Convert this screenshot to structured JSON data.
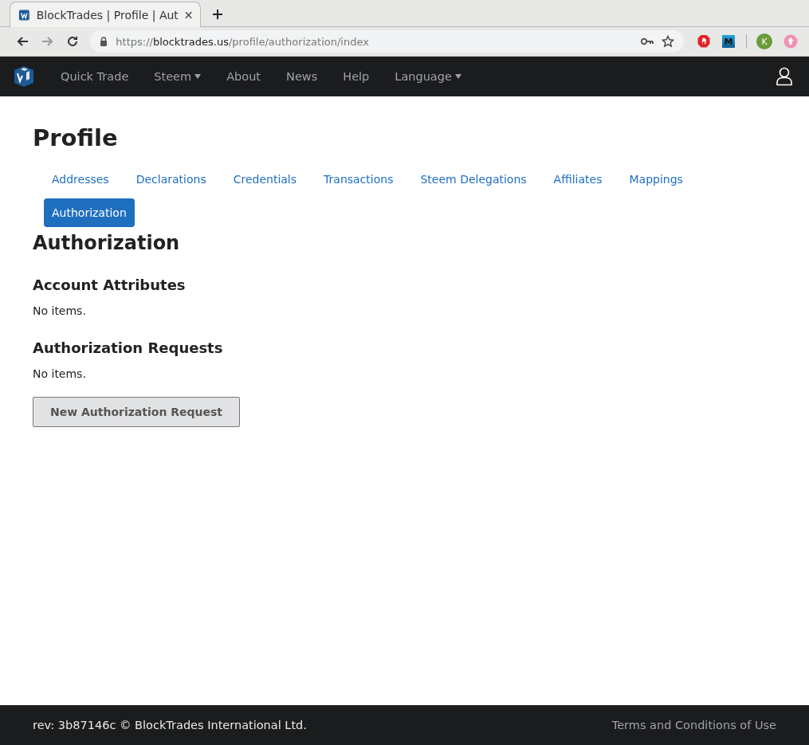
{
  "browser": {
    "tab": {
      "title": "BlockTrades | Profile | Aut"
    },
    "nav_buttons": [
      {
        "kind": "back",
        "disabled": false
      },
      {
        "kind": "forward",
        "disabled": true
      },
      {
        "kind": "reload",
        "disabled": false
      }
    ],
    "url": {
      "scheme": "https://",
      "host": "blocktrades.us",
      "path": "/profile/authorization/index"
    },
    "extensions": [
      {
        "kind": "blocker"
      },
      {
        "kind": "letter",
        "label": "M"
      },
      {
        "kind": "divider"
      },
      {
        "kind": "avatar",
        "label": "K"
      },
      {
        "kind": "upload"
      }
    ]
  },
  "navbar": {
    "items": [
      {
        "label": "Quick Trade",
        "dropdown": false
      },
      {
        "label": "Steem",
        "dropdown": true
      },
      {
        "label": "About",
        "dropdown": false
      },
      {
        "label": "News",
        "dropdown": false
      },
      {
        "label": "Help",
        "dropdown": false
      },
      {
        "label": "Language",
        "dropdown": true
      }
    ]
  },
  "page": {
    "title": "Profile",
    "tabs": [
      {
        "label": "Addresses",
        "selected": false
      },
      {
        "label": "Declarations",
        "selected": false
      },
      {
        "label": "Credentials",
        "selected": false
      },
      {
        "label": "Transactions",
        "selected": false
      },
      {
        "label": "Steem Delegations",
        "selected": false
      },
      {
        "label": "Affiliates",
        "selected": false
      },
      {
        "label": "Mappings",
        "selected": false
      },
      {
        "label": "Authorization",
        "selected": true
      }
    ],
    "heading": "Authorization",
    "sections": [
      {
        "title": "Account Attributes",
        "text": "No items."
      },
      {
        "title": "Authorization Requests",
        "text": "No items."
      }
    ],
    "button": "New Authorization Request"
  },
  "footer": {
    "text": "rev: 3b87146c © BlockTrades International Ltd.",
    "link": "Terms and Conditions of Use"
  }
}
